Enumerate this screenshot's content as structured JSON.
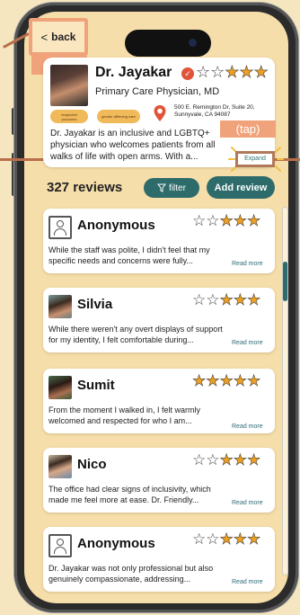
{
  "back": {
    "label": "back",
    "chevron": "<"
  },
  "annotations": {
    "tap_back": "(tap)",
    "tap_expand": "(tap)"
  },
  "doctor": {
    "name": "Dr. Jayakar",
    "verified_symbol": "✓",
    "title": "Primary Care Physician, MD",
    "rating_stars": "☆☆★★★",
    "badges": [
      "respected pronouns",
      "gender affirming care"
    ],
    "address": "500 E. Remington Dr, Suite 20, Sunnyvale, CA 94087",
    "bio": "Dr. Jayakar is an inclusive and LGBTQ+ physician who welcomes patients from all walks of life with open arms. With a...",
    "expand_label": "Expand"
  },
  "reviews_header": {
    "count_label": "327 reviews",
    "filter_label": "filter",
    "add_label": "Add review"
  },
  "reviews": [
    {
      "name": "Anonymous",
      "stars": "☆☆★★★",
      "text": "While the staff was polite, I didn't feel that my specific needs and concerns were fully...",
      "read_more": "Read more"
    },
    {
      "name": "Silvia",
      "stars": "☆☆★★★",
      "text": "While there weren't any overt displays of support for my identity, I felt comfortable during...",
      "read_more": "Read more"
    },
    {
      "name": "Sumit",
      "stars": "★★★★★",
      "text": "From the moment I walked in, I felt warmly welcomed and respected for who I am...",
      "read_more": "Read more"
    },
    {
      "name": "Nico",
      "stars": "☆☆★★★",
      "text": "The office had clear signs of inclusivity, which made me feel more at ease. Dr. Friendly...",
      "read_more": "Read more"
    },
    {
      "name": "Anonymous",
      "stars": "☆☆★★★",
      "text": "Dr. Jayakar was not only professional but also genuinely compassionate, addressing...",
      "read_more": "Read more"
    }
  ],
  "colors": {
    "accent": "#2e6b6b",
    "tap": "#f0a37a",
    "star": "#f0a020",
    "background": "#f6deaa"
  }
}
